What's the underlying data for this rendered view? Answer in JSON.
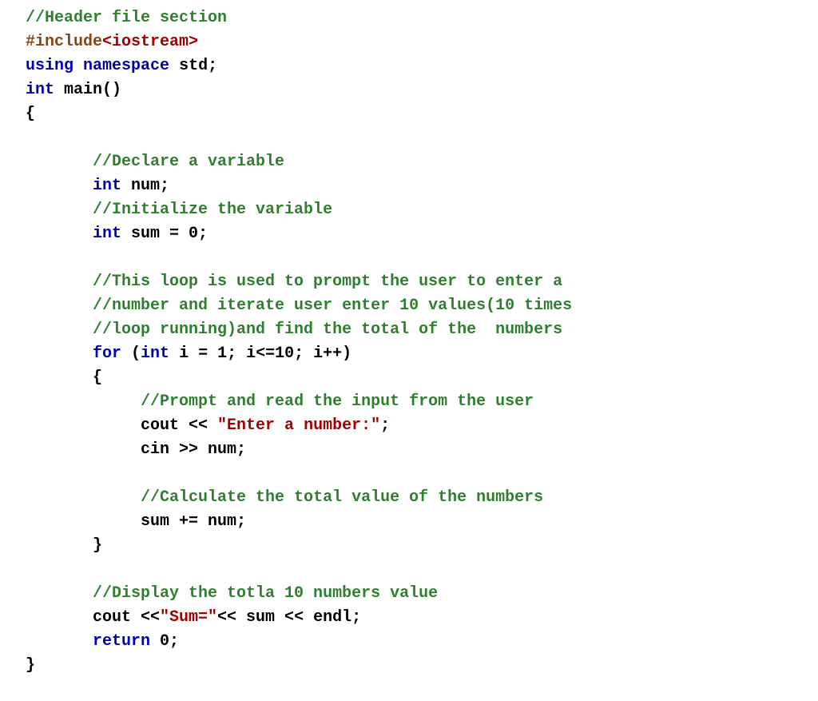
{
  "code": {
    "lines": [
      {
        "indent": "",
        "tokens": [
          {
            "cls": "c-comment",
            "t": "//Header file section"
          }
        ]
      },
      {
        "indent": "",
        "tokens": [
          {
            "cls": "c-pre",
            "t": "#include"
          },
          {
            "cls": "c-include",
            "t": "<iostream>"
          }
        ]
      },
      {
        "indent": "",
        "tokens": [
          {
            "cls": "c-kw",
            "t": "using"
          },
          {
            "cls": "c-id",
            "t": " "
          },
          {
            "cls": "c-kw",
            "t": "namespace"
          },
          {
            "cls": "c-id",
            "t": " std;"
          }
        ]
      },
      {
        "indent": "",
        "tokens": [
          {
            "cls": "c-kw",
            "t": "int"
          },
          {
            "cls": "c-id",
            "t": " main()"
          }
        ]
      },
      {
        "indent": "",
        "tokens": [
          {
            "cls": "c-id",
            "t": "{"
          }
        ]
      },
      {
        "indent": "",
        "tokens": []
      },
      {
        "indent": "       ",
        "tokens": [
          {
            "cls": "c-comment",
            "t": "//Declare a variable"
          }
        ]
      },
      {
        "indent": "       ",
        "tokens": [
          {
            "cls": "c-kw",
            "t": "int"
          },
          {
            "cls": "c-id",
            "t": " num;"
          }
        ]
      },
      {
        "indent": "       ",
        "tokens": [
          {
            "cls": "c-comment",
            "t": "//Initialize the variable"
          }
        ]
      },
      {
        "indent": "       ",
        "tokens": [
          {
            "cls": "c-kw",
            "t": "int"
          },
          {
            "cls": "c-id",
            "t": " sum = 0;"
          }
        ]
      },
      {
        "indent": "",
        "tokens": []
      },
      {
        "indent": "       ",
        "tokens": [
          {
            "cls": "c-comment",
            "t": "//This loop is used to prompt the user to enter a"
          }
        ]
      },
      {
        "indent": "       ",
        "tokens": [
          {
            "cls": "c-comment",
            "t": "//number and iterate user enter 10 values(10 times"
          }
        ]
      },
      {
        "indent": "       ",
        "tokens": [
          {
            "cls": "c-comment",
            "t": "//loop running)and find the total of the  numbers"
          }
        ]
      },
      {
        "indent": "       ",
        "tokens": [
          {
            "cls": "c-kw",
            "t": "for"
          },
          {
            "cls": "c-id",
            "t": " ("
          },
          {
            "cls": "c-kw",
            "t": "int"
          },
          {
            "cls": "c-id",
            "t": " i = 1; i<=10; i++)"
          }
        ]
      },
      {
        "indent": "       ",
        "tokens": [
          {
            "cls": "c-id",
            "t": "{"
          }
        ]
      },
      {
        "indent": "            ",
        "tokens": [
          {
            "cls": "c-comment",
            "t": "//Prompt and read the input from the user"
          }
        ]
      },
      {
        "indent": "            ",
        "tokens": [
          {
            "cls": "c-id",
            "t": "cout << "
          },
          {
            "cls": "c-str",
            "t": "\"Enter a number:\""
          },
          {
            "cls": "c-id",
            "t": ";"
          }
        ]
      },
      {
        "indent": "            ",
        "tokens": [
          {
            "cls": "c-id",
            "t": "cin >> num;"
          }
        ]
      },
      {
        "indent": "",
        "tokens": []
      },
      {
        "indent": "            ",
        "tokens": [
          {
            "cls": "c-comment",
            "t": "//Calculate the total value of the numbers"
          }
        ]
      },
      {
        "indent": "            ",
        "tokens": [
          {
            "cls": "c-id",
            "t": "sum += num;"
          }
        ]
      },
      {
        "indent": "       ",
        "tokens": [
          {
            "cls": "c-id",
            "t": "}"
          }
        ]
      },
      {
        "indent": "",
        "tokens": []
      },
      {
        "indent": "       ",
        "tokens": [
          {
            "cls": "c-comment",
            "t": "//Display the totla 10 numbers value"
          }
        ]
      },
      {
        "indent": "       ",
        "tokens": [
          {
            "cls": "c-id",
            "t": "cout <<"
          },
          {
            "cls": "c-str",
            "t": "\"Sum=\""
          },
          {
            "cls": "c-id",
            "t": "<< sum << endl;"
          }
        ]
      },
      {
        "indent": "       ",
        "tokens": [
          {
            "cls": "c-kw",
            "t": "return"
          },
          {
            "cls": "c-id",
            "t": " 0;"
          }
        ]
      },
      {
        "indent": "",
        "tokens": [
          {
            "cls": "c-id",
            "t": "}"
          }
        ]
      }
    ]
  }
}
